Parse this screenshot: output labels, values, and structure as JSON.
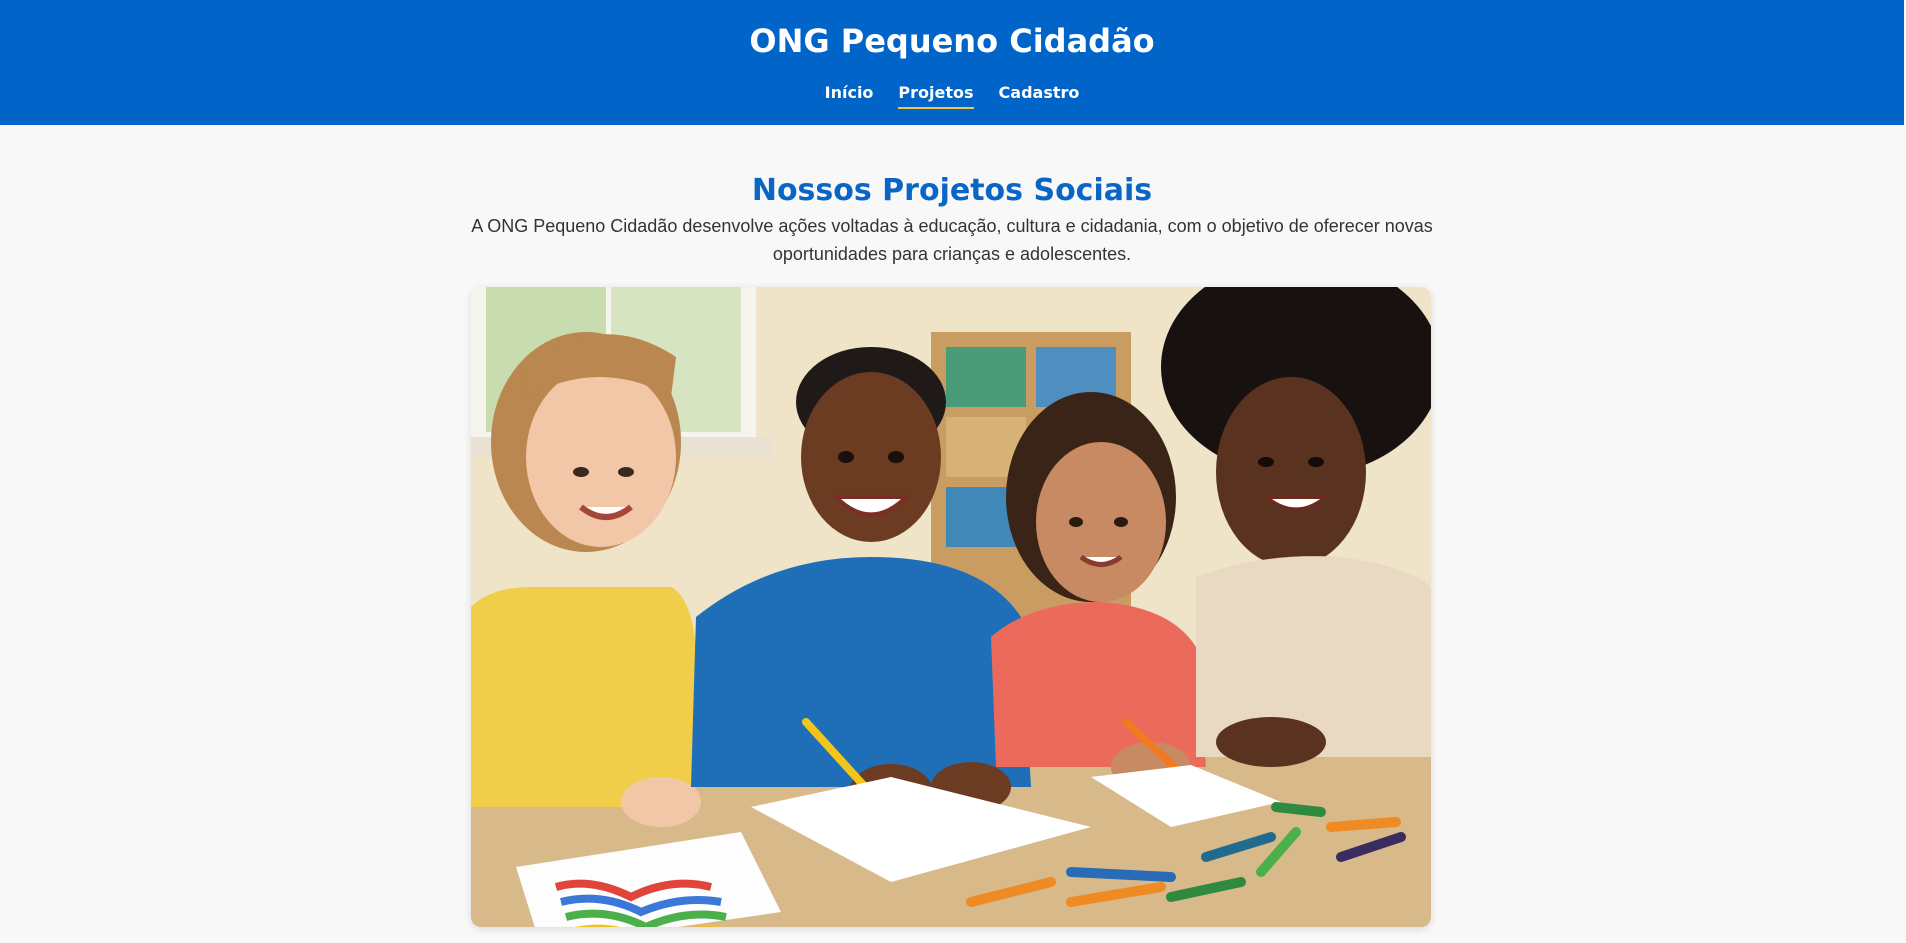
{
  "header": {
    "title": "ONG Pequeno Cidadão",
    "nav": [
      {
        "label": "Início",
        "active": false
      },
      {
        "label": "Projetos",
        "active": true
      },
      {
        "label": "Cadastro",
        "active": false
      }
    ]
  },
  "projects": {
    "title": "Nossos Projetos Sociais",
    "description": "A ONG Pequeno Cidadão desenvolve ações voltadas à educação, cultura e cidadania, com o objetivo de oferecer novas oportunidades para crianças e adolescentes.",
    "image": {
      "subject": "children-drawing-illustration"
    }
  },
  "colors": {
    "header_bg": "#0064c9",
    "title_blue": "#0a66c6",
    "nav_active_underline": "#f4c542",
    "page_bg": "#f8f8f8"
  }
}
